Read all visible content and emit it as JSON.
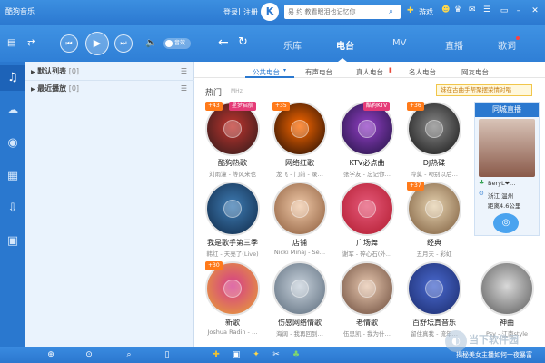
{
  "app": {
    "title": "酷狗音乐"
  },
  "top": {
    "login": "登录",
    "divider": "|",
    "register": "注册",
    "logo_letter": "K",
    "search_placeholder": "易 约  教看眼泪也记忆你",
    "game_label": "游戏"
  },
  "player": {
    "volume_toggle": "音效"
  },
  "nav": {
    "tabs": [
      "乐库",
      "电台",
      "MV",
      "直播",
      "歌词"
    ],
    "active": "电台"
  },
  "playlists": [
    {
      "label": "默认列表",
      "count": "[0]"
    },
    {
      "label": "最近播放",
      "count": "[0]"
    }
  ],
  "radio": {
    "subtabs": [
      "公共电台",
      "有声电台",
      "真人电台",
      "名人电台",
      "网友电台"
    ],
    "hot_label": "热门",
    "hot_sub": "MHz",
    "promo": "妹在古曲手帮聚摆荣情对唱",
    "stations": [
      {
        "name": "酷狗热歌",
        "desc": "刘雨潼 - 等风来也",
        "badge": "+43",
        "tag": "星梦启航",
        "colors": [
          "#2b1a1a",
          "#c2352f"
        ]
      },
      {
        "name": "网络红歌",
        "desc": "龙飞 - 门前 - 录…",
        "badge": "+35",
        "tag": "",
        "colors": [
          "#1a0a05",
          "#ff6a00"
        ]
      },
      {
        "name": "KTV必点曲",
        "desc": "张学友 - 忘记你…",
        "badge": "",
        "tag": "酷狗KTV",
        "colors": [
          "#1f1240",
          "#9440c7"
        ]
      },
      {
        "name": "DJ热碟",
        "desc": "冷莫 - 吻别以后…",
        "badge": "+36",
        "tag": "",
        "colors": [
          "#141414",
          "#8a8a8a"
        ]
      },
      {
        "name": "我是歌手第三季",
        "desc": "韩红 - 天亮了(Live)",
        "badge": "",
        "tag": "",
        "colors": [
          "#0f2846",
          "#3f7db5"
        ]
      },
      {
        "name": "店铺",
        "desc": "Nicki Minaj - Se…",
        "badge": "",
        "tag": "",
        "colors": [
          "#8a5a3a",
          "#f0c9a8"
        ]
      },
      {
        "name": "广场舞",
        "desc": "谢军 - 碎心石(外…",
        "badge": "",
        "tag": "",
        "colors": [
          "#b01a2e",
          "#e65a7a"
        ]
      },
      {
        "name": "经典",
        "desc": "五月天 - 彩虹",
        "badge": "+37",
        "tag": "",
        "colors": [
          "#7a5a3a",
          "#e6d2b0"
        ]
      },
      {
        "name": "新歌",
        "desc": "Joshua Radin - …",
        "badge": "+30",
        "tag": "",
        "colors": [
          "#e8a531",
          "#d43a8c"
        ]
      },
      {
        "name": "伤感网络情歌",
        "desc": "海阔 - 我再回到…",
        "badge": "",
        "tag": "",
        "colors": [
          "#5a6a7a",
          "#c8d2dc"
        ]
      },
      {
        "name": "老情歌",
        "desc": "伍思凯 - 我为什…",
        "badge": "",
        "tag": "",
        "colors": [
          "#6a4a3a",
          "#e8c8b0"
        ]
      },
      {
        "name": "百舒坛真音乐",
        "desc": "留住真我 - 流年…",
        "badge": "",
        "tag": "",
        "colors": [
          "#1a2a6a",
          "#4a6ad0"
        ]
      }
    ],
    "extra": {
      "name": "神曲",
      "desc": "Psy - 江南style"
    }
  },
  "live": {
    "title": "同城直播",
    "user": "BeryL❤…",
    "location": "浙江 温州",
    "distance": "距离4.6公里"
  },
  "bottom": {
    "status": "揭秘美女主播如何一夜暴富",
    "watermark": "当下软件园"
  },
  "colors": {
    "accent": "#2a78cf",
    "orange": "#ff7a1a"
  }
}
